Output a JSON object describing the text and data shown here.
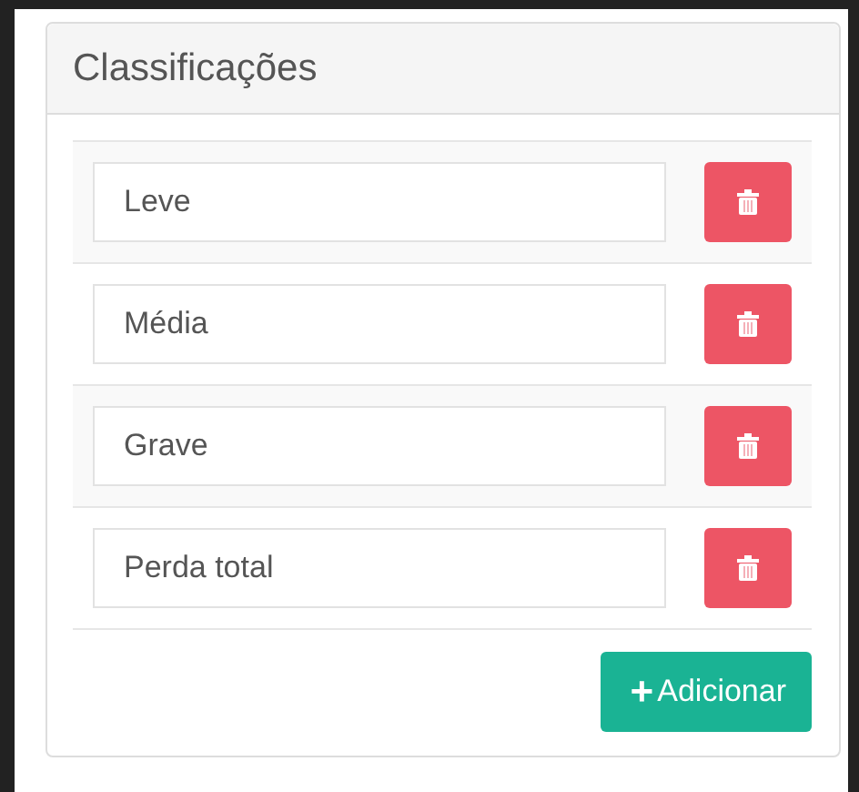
{
  "panel": {
    "title": "Classificações"
  },
  "items": [
    {
      "value": "Leve"
    },
    {
      "value": "Média"
    },
    {
      "value": "Grave"
    },
    {
      "value": "Perda total"
    }
  ],
  "add_button": {
    "icon": "+",
    "label": "Adicionar"
  }
}
